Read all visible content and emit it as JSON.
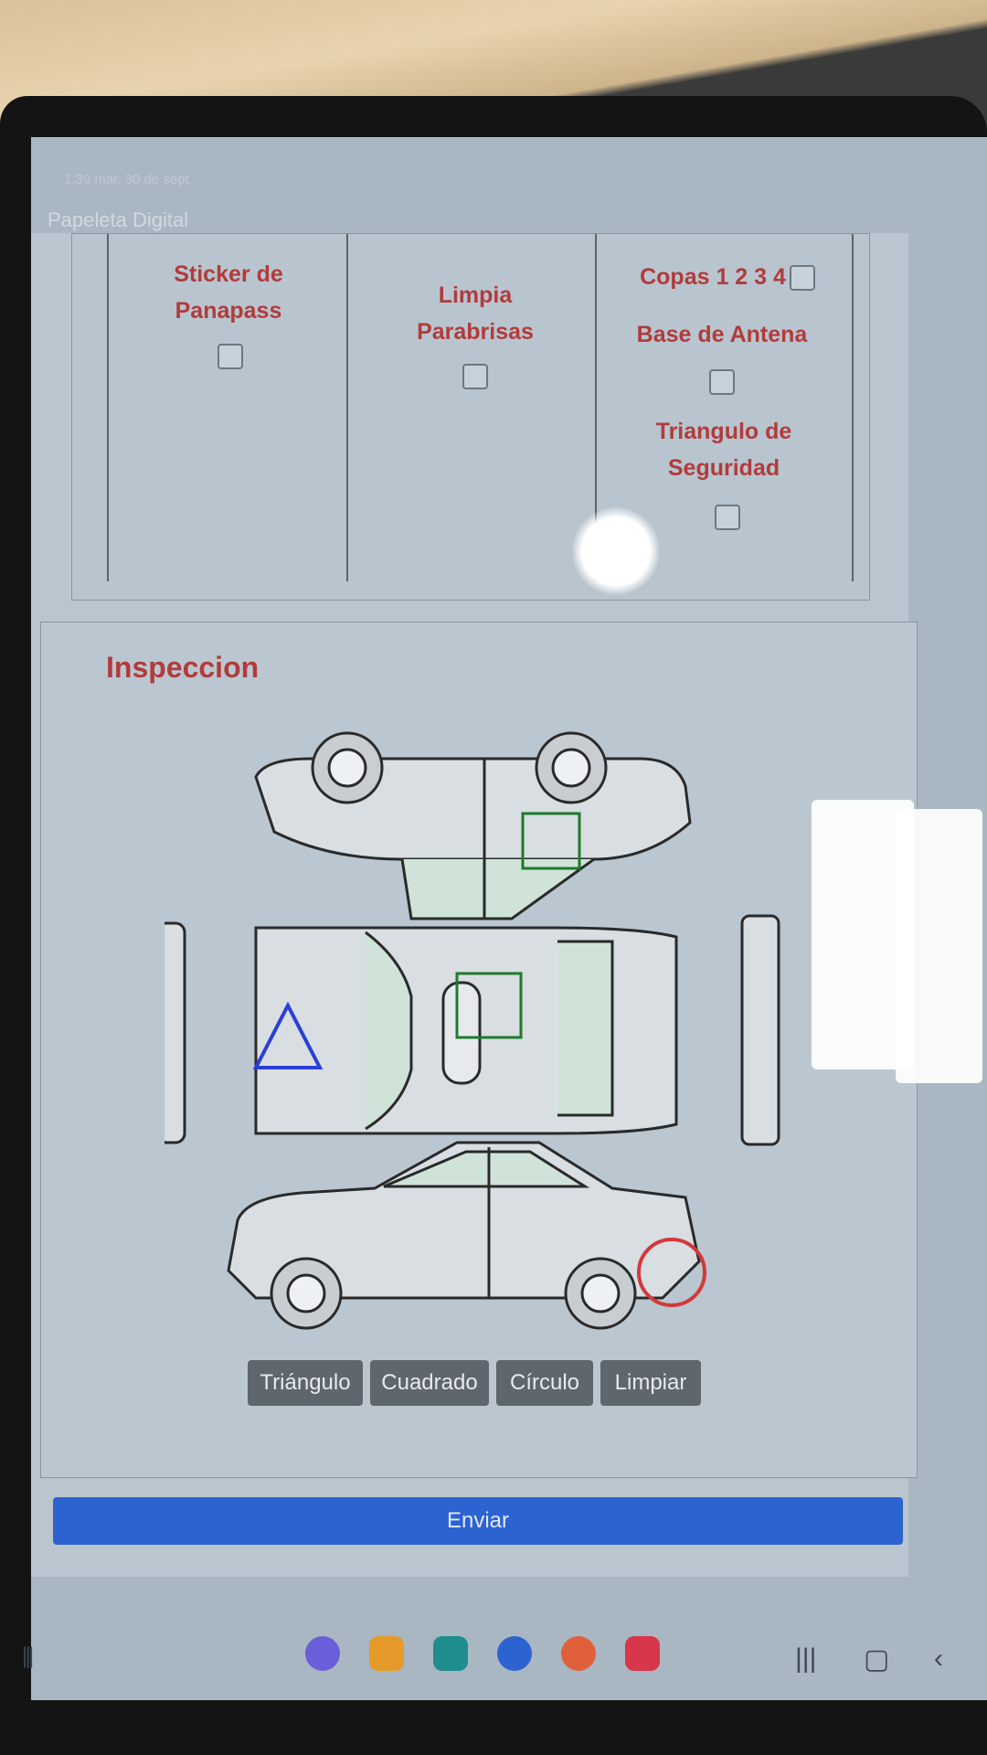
{
  "status": {
    "time": "1:39 mar, 30 de sept."
  },
  "app": {
    "title": "Papeleta Digital"
  },
  "checklist": {
    "col1": {
      "label_line1": "Sticker de",
      "label_line2": "Panapass"
    },
    "col2": {
      "label_line1": "Limpia",
      "label_line2": "Parabrisas"
    },
    "col3": {
      "copas": "Copas 1 2 3 4",
      "antena": "Base de Antena",
      "triangulo_line1": "Triangulo de",
      "triangulo_line2": "Seguridad"
    }
  },
  "inspection": {
    "title": "Inspeccion",
    "buttons": {
      "triangle": "Triángulo",
      "square": "Cuadrado",
      "circle": "Círculo",
      "clear": "Limpiar"
    }
  },
  "form": {
    "submit_label": "Enviar"
  },
  "colors": {
    "accent": "#2d62d1",
    "label_red": "#b23b3b",
    "mark_blue": "#2b3fd6",
    "mark_green": "#1f7a2a",
    "mark_red": "#d23a3a"
  },
  "icons": [
    "menu-icon",
    "browser-icon",
    "notes-icon",
    "calendar-icon",
    "messages-icon",
    "contacts-icon",
    "camera-icon",
    "recents-icon",
    "home-icon",
    "back-icon"
  ]
}
